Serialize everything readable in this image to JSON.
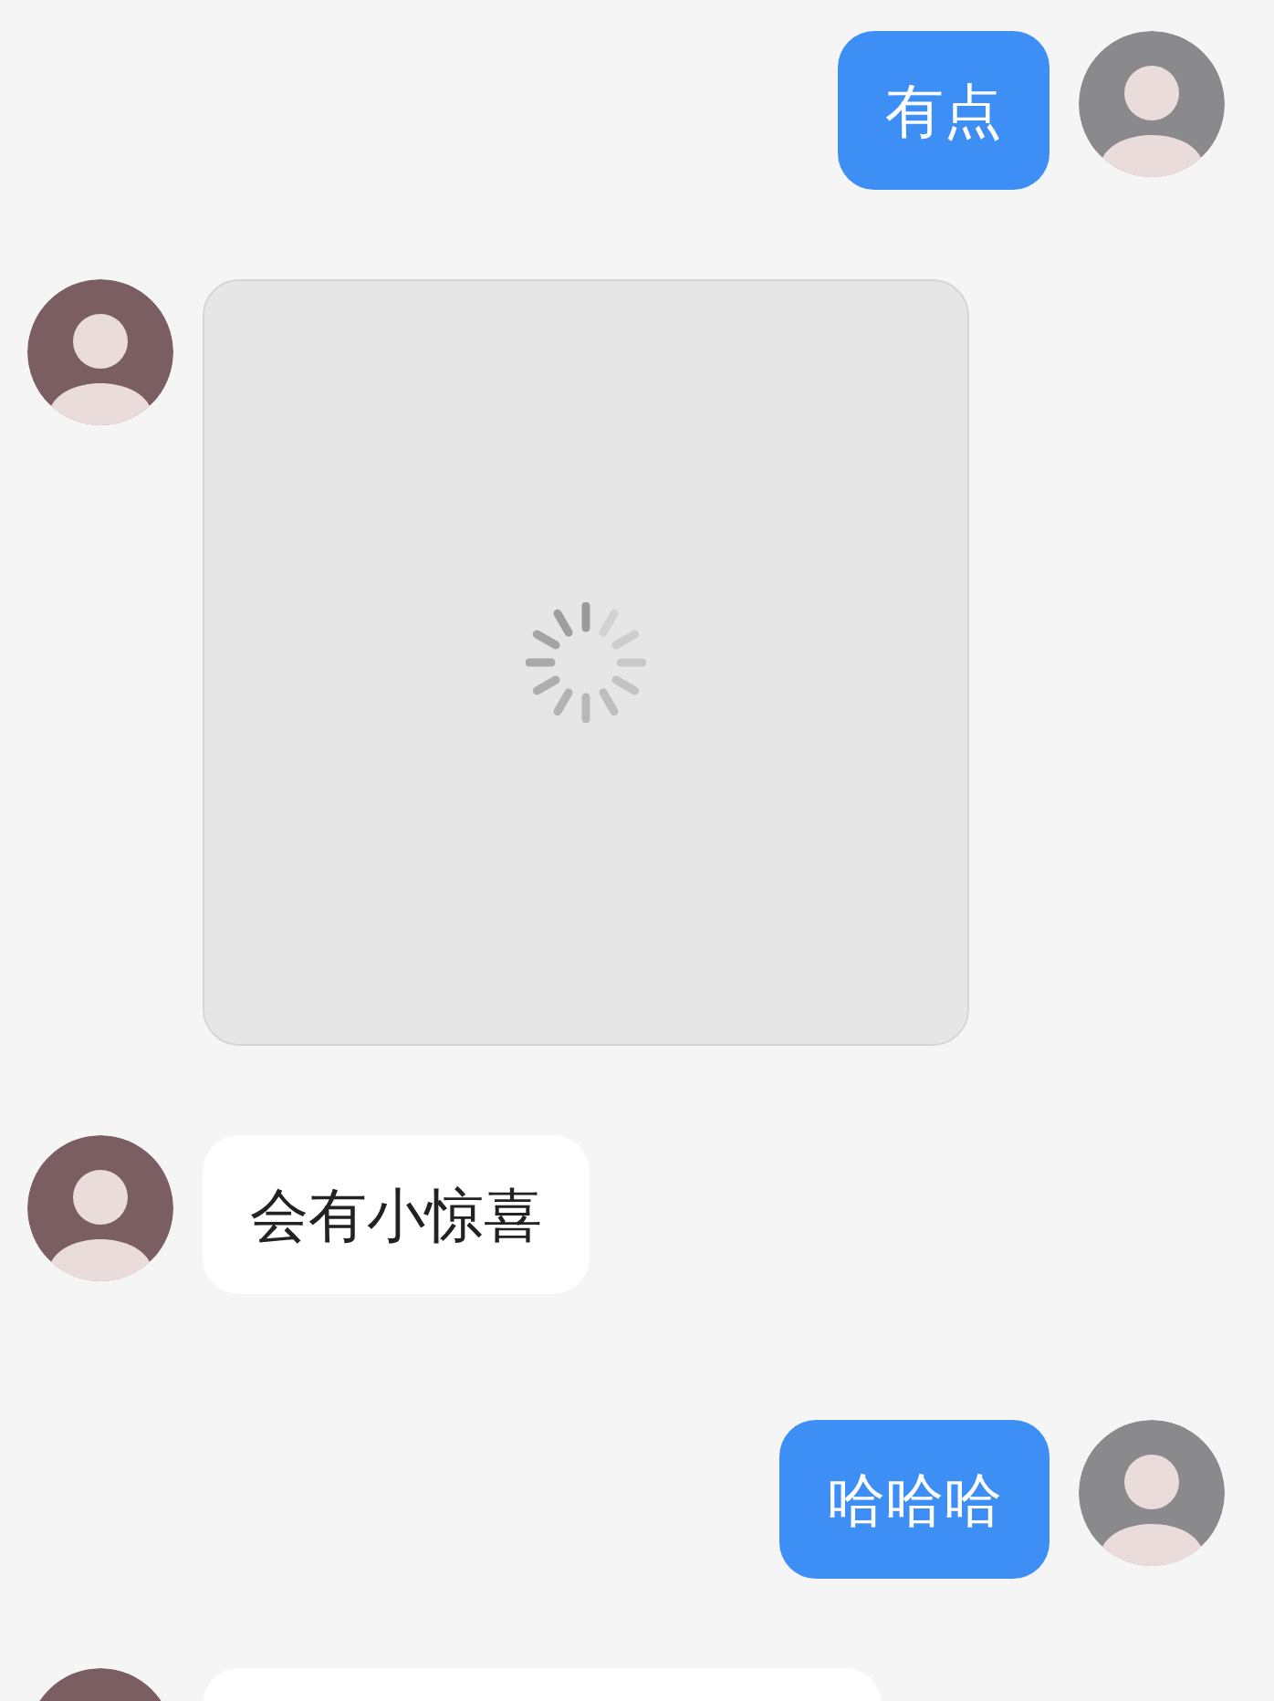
{
  "messages": [
    {
      "outgoing": true,
      "kind": "text",
      "text": "有点"
    },
    {
      "outgoing": false,
      "kind": "image_loading"
    },
    {
      "outgoing": false,
      "kind": "text",
      "text": "会有小惊喜"
    },
    {
      "outgoing": true,
      "kind": "text",
      "text": "哈哈哈"
    },
    {
      "outgoing": false,
      "kind": "cut"
    }
  ]
}
